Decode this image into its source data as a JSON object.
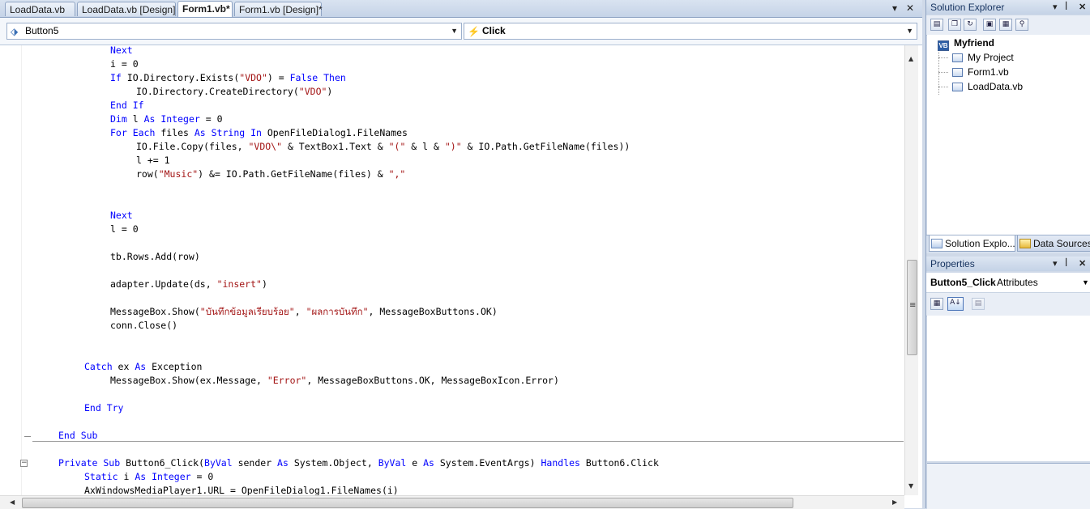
{
  "tabs": [
    {
      "label": "LoadData.vb",
      "active": false
    },
    {
      "label": "LoadData.vb [Design]",
      "active": false
    },
    {
      "label": "Form1.vb*",
      "active": true
    },
    {
      "label": "Form1.vb [Design]*",
      "active": false
    }
  ],
  "nav": {
    "object_combo": "Button5",
    "event_combo": "Click"
  },
  "code_lines": [
    {
      "indent": 12,
      "parts": [
        [
          "kw",
          "Next"
        ]
      ]
    },
    {
      "indent": 12,
      "parts": [
        [
          "",
          "i = 0"
        ]
      ]
    },
    {
      "indent": 12,
      "parts": [
        [
          "kw",
          "If "
        ],
        [
          "",
          "IO.Directory.Exists("
        ],
        [
          "str",
          "\"VDO\""
        ],
        [
          "",
          ") = "
        ],
        [
          "kw",
          "False Then"
        ]
      ]
    },
    {
      "indent": 16,
      "parts": [
        [
          "",
          "IO.Directory.CreateDirectory("
        ],
        [
          "str",
          "\"VDO\""
        ],
        [
          "",
          ")"
        ]
      ]
    },
    {
      "indent": 12,
      "parts": [
        [
          "kw",
          "End If"
        ]
      ]
    },
    {
      "indent": 12,
      "parts": [
        [
          "kw",
          "Dim "
        ],
        [
          "",
          "l "
        ],
        [
          "kw",
          "As Integer"
        ],
        [
          "",
          " = 0"
        ]
      ]
    },
    {
      "indent": 12,
      "parts": [
        [
          "kw",
          "For Each "
        ],
        [
          "",
          "files "
        ],
        [
          "kw",
          "As String In "
        ],
        [
          "",
          "OpenFileDialog1.FileNames"
        ]
      ]
    },
    {
      "indent": 16,
      "parts": [
        [
          "",
          "IO.File.Copy(files, "
        ],
        [
          "str",
          "\"VDO\\\""
        ],
        [
          "",
          " & TextBox1.Text & "
        ],
        [
          "str",
          "\"(\""
        ],
        [
          "",
          " & l & "
        ],
        [
          "str",
          "\")\""
        ],
        [
          "",
          " & IO.Path.GetFileName(files))"
        ]
      ]
    },
    {
      "indent": 16,
      "parts": [
        [
          "",
          "l += 1"
        ]
      ]
    },
    {
      "indent": 16,
      "parts": [
        [
          "",
          "row("
        ],
        [
          "str",
          "\"Music\""
        ],
        [
          "",
          ") &= IO.Path.GetFileName(files) & "
        ],
        [
          "str",
          "\",\""
        ]
      ]
    },
    {
      "indent": 0,
      "parts": []
    },
    {
      "indent": 0,
      "parts": []
    },
    {
      "indent": 12,
      "parts": [
        [
          "kw",
          "Next"
        ]
      ]
    },
    {
      "indent": 12,
      "parts": [
        [
          "",
          "l = 0"
        ]
      ]
    },
    {
      "indent": 0,
      "parts": []
    },
    {
      "indent": 12,
      "parts": [
        [
          "",
          "tb.Rows.Add(row)"
        ]
      ]
    },
    {
      "indent": 0,
      "parts": []
    },
    {
      "indent": 12,
      "parts": [
        [
          "",
          "adapter.Update(ds, "
        ],
        [
          "str",
          "\"insert\""
        ],
        [
          "",
          ")"
        ]
      ]
    },
    {
      "indent": 0,
      "parts": []
    },
    {
      "indent": 12,
      "parts": [
        [
          "",
          "MessageBox.Show("
        ],
        [
          "str",
          "\"บันทึกข้อมูลเรียบร้อย\""
        ],
        [
          "",
          ", "
        ],
        [
          "str",
          "\"ผลการบันทึก\""
        ],
        [
          "",
          ", MessageBoxButtons.OK)"
        ]
      ]
    },
    {
      "indent": 12,
      "parts": [
        [
          "",
          "conn.Close()"
        ]
      ]
    },
    {
      "indent": 0,
      "parts": []
    },
    {
      "indent": 0,
      "parts": []
    },
    {
      "indent": 8,
      "parts": [
        [
          "kw",
          "Catch "
        ],
        [
          "",
          "ex "
        ],
        [
          "kw",
          "As "
        ],
        [
          "",
          "Exception"
        ]
      ]
    },
    {
      "indent": 12,
      "parts": [
        [
          "",
          "MessageBox.Show(ex.Message, "
        ],
        [
          "str",
          "\"Error\""
        ],
        [
          "",
          ", MessageBoxButtons.OK, MessageBoxIcon.Error)"
        ]
      ]
    },
    {
      "indent": 0,
      "parts": []
    },
    {
      "indent": 8,
      "parts": [
        [
          "kw",
          "End Try"
        ]
      ]
    },
    {
      "indent": 0,
      "parts": []
    },
    {
      "indent": 4,
      "parts": [
        [
          "kw",
          "End Sub"
        ]
      ]
    },
    {
      "indent": 0,
      "parts": []
    },
    {
      "indent": 4,
      "parts": [
        [
          "kw",
          "Private Sub "
        ],
        [
          "",
          "Button6_Click("
        ],
        [
          "kw",
          "ByVal "
        ],
        [
          "",
          "sender "
        ],
        [
          "kw",
          "As "
        ],
        [
          "",
          "System.Object, "
        ],
        [
          "kw",
          "ByVal "
        ],
        [
          "",
          "e "
        ],
        [
          "kw",
          "As "
        ],
        [
          "",
          "System.EventArgs) "
        ],
        [
          "kw",
          "Handles "
        ],
        [
          "",
          "Button6.Click"
        ]
      ]
    },
    {
      "indent": 8,
      "parts": [
        [
          "kw",
          "Static "
        ],
        [
          "",
          "i "
        ],
        [
          "kw",
          "As Integer"
        ],
        [
          "",
          " = 0"
        ]
      ]
    },
    {
      "indent": 8,
      "parts": [
        [
          "",
          "AxWindowsMediaPlayer1.URL = OpenFileDialog1.FileNames(i)"
        ]
      ]
    }
  ],
  "solution_explorer": {
    "title": "Solution Explorer",
    "root": "Myfriend",
    "items": [
      "My Project",
      "Form1.vb",
      "LoadData.vb"
    ],
    "tabs": [
      "Solution Explo...",
      "Data Sources"
    ]
  },
  "properties": {
    "title": "Properties",
    "object_name": "Button5_Click",
    "object_type": "Attributes"
  },
  "colors": {
    "keyword": "#0000ff",
    "string": "#a31515",
    "panel_bg": "#cfd9e8"
  }
}
